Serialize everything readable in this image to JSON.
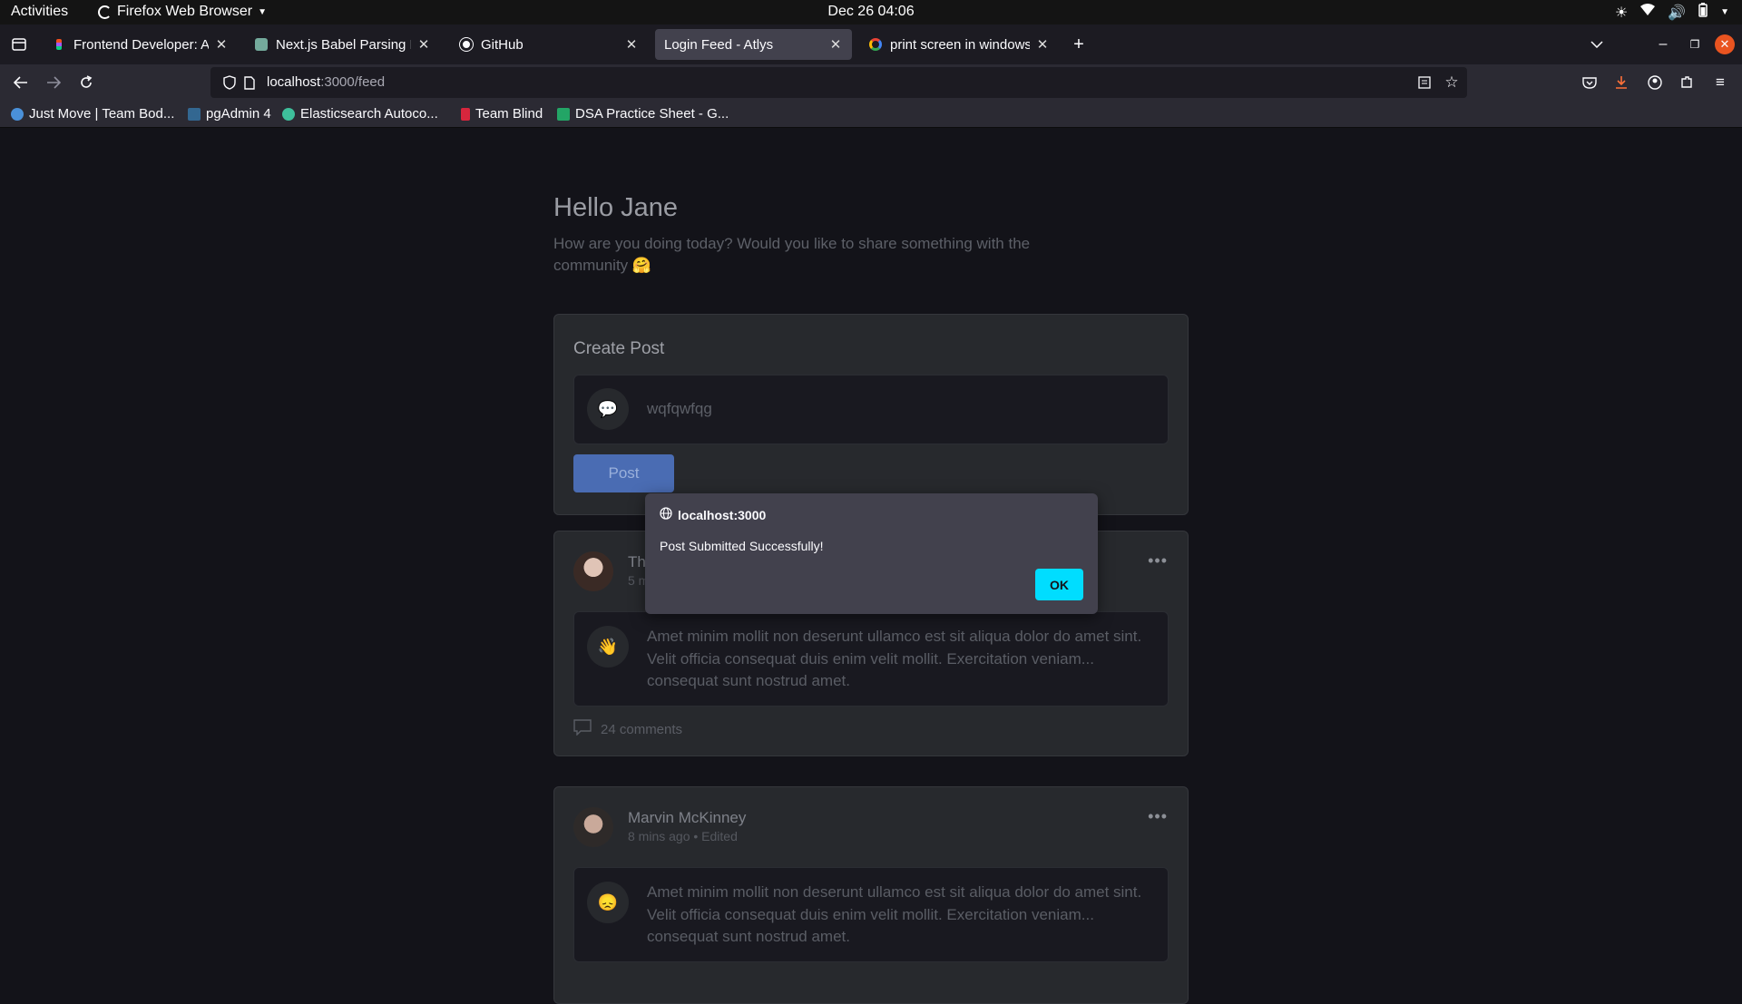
{
  "system": {
    "activities": "Activities",
    "app_menu": "Firefox Web Browser",
    "clock": "Dec 26  04:06"
  },
  "browser": {
    "tabs": [
      {
        "label": "Frontend Developer: Atlys",
        "active": false
      },
      {
        "label": "Next.js Babel Parsing Error",
        "active": false
      },
      {
        "label": "GitHub",
        "active": false
      },
      {
        "label": "Login Feed - Atlys",
        "active": true
      },
      {
        "label": "print screen in windows",
        "active": false
      }
    ],
    "url_host": "localhost",
    "url_path": ":3000/feed",
    "bookmarks": [
      {
        "label": "Just Move | Team Bod...",
        "color": "#4a90d9"
      },
      {
        "label": "pgAdmin 4",
        "color": "#336791"
      },
      {
        "label": "Elasticsearch Autoco...",
        "color": "#3ebf9b"
      },
      {
        "label": "Team Blind",
        "color": "#d7263d"
      },
      {
        "label": "DSA Practice Sheet - G...",
        "color": "#23a566"
      }
    ]
  },
  "feed": {
    "greeting": "Hello Jane",
    "subtitle": "How are you doing today? Would you like to share something with the community 🤗",
    "create_post": {
      "title": "Create Post",
      "emoji": "💬",
      "input_value": "wqfqwfqg",
      "post_button": "Post"
    },
    "posts": [
      {
        "author": "Th",
        "meta": "5 m",
        "emoji": "👋",
        "text": "Amet minim mollit non deserunt ullamco est sit aliqua dolor do amet sint. Velit officia consequat duis enim velit mollit. Exercitation veniam... consequat sunt nostrud amet.",
        "comments": "24 comments"
      },
      {
        "author": "Marvin McKinney",
        "meta": "8 mins ago • Edited",
        "emoji": "😞",
        "text": "Amet minim mollit non deserunt ullamco est sit aliqua dolor do amet sint. Velit officia consequat duis enim velit mollit. Exercitation veniam... consequat sunt nostrud amet."
      }
    ]
  },
  "dialog": {
    "origin": "localhost:3000",
    "message": "Post Submitted Successfully!",
    "ok_label": "OK"
  },
  "colors": {
    "page_bg": "#131319",
    "card_bg": "#27292d",
    "post_button": "#4a6cb3",
    "dialog_ok": "#00ddff"
  }
}
